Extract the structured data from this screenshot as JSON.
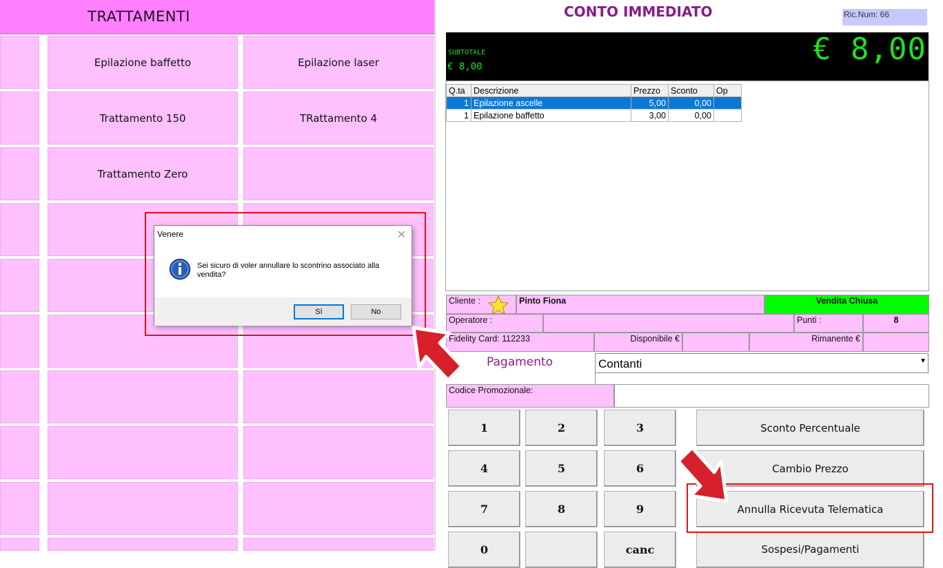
{
  "left_panel": {
    "title": "TRATTAMENTI",
    "tiles": [
      "Epilazione baffetto",
      "Epilazione laser",
      "Trattamento 150",
      "TRattamento 4",
      "Trattamento Zero"
    ]
  },
  "header": {
    "title": "CONTO IMMEDIATO",
    "ric_num": "Ric.Num: 66"
  },
  "display": {
    "subtotal_label": "SUBTOTALE",
    "subtotal_value": "€ 8,00",
    "total": "€ 8,00"
  },
  "items_table": {
    "columns": [
      "Q.ta",
      "Descrizione",
      "Prezzo",
      "Sconto",
      "Op"
    ],
    "rows": [
      {
        "qta": "1",
        "descrizione": "Epilazione ascelle",
        "prezzo": "5,00",
        "sconto": "0,00",
        "op": ""
      },
      {
        "qta": "1",
        "descrizione": "Epilazione baffetto",
        "prezzo": "3,00",
        "sconto": "0,00",
        "op": ""
      }
    ]
  },
  "info": {
    "cliente_label": "Cliente :",
    "cliente_value": "Pinto Fiona",
    "status": "Vendita Chiusa",
    "operatore_label": "Operatore :",
    "punti_label": "Punti :",
    "punti_value": "8",
    "fidelity_label": "Fidelity Card: 112233",
    "disponibile_label": "Disponibile €",
    "rimanente_label": "Rimanente €",
    "pagamento_label": "Pagamento",
    "pagamento_value": "Contanti",
    "codice_label": "Codice Promozionale:"
  },
  "keypad": [
    "1",
    "2",
    "3",
    "4",
    "5",
    "6",
    "7",
    "8",
    "9",
    "0",
    "",
    "canc"
  ],
  "function_buttons": [
    "Sconto Percentuale",
    "Cambio Prezzo",
    "Annulla Ricevuta Telematica",
    "Sospesi/Pagamenti"
  ],
  "dialog": {
    "title": "Venere",
    "message": "Sei sicuro di voler annullare lo scontrino associato alla vendita?",
    "yes": "Sì",
    "no": "No"
  },
  "colors": {
    "tile_pink": "#ffc0ff",
    "title_pink": "#ff80ff",
    "status_green": "#00ff00",
    "display_green": "#20e020",
    "highlight_red": "#e01010",
    "selection_blue": "#0a78d7"
  },
  "icons": [
    "star-icon",
    "info-icon",
    "close-icon",
    "dropdown-arrow-icon",
    "pointer-arrow-icon"
  ]
}
